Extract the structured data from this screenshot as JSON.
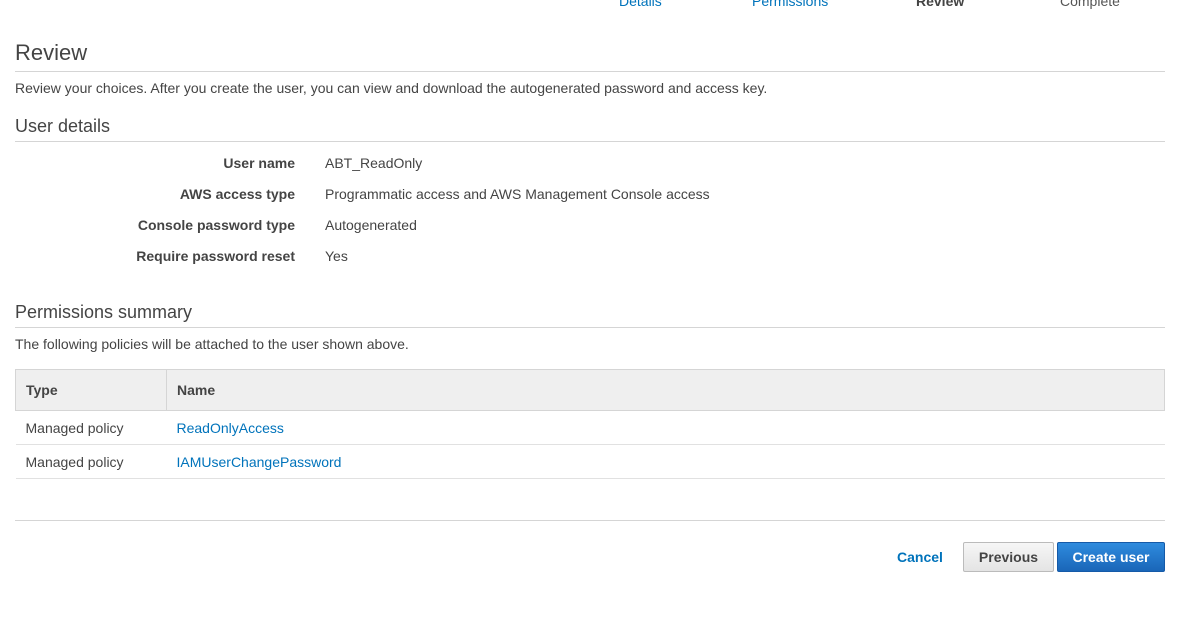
{
  "wizard_steps": [
    {
      "label": "Details",
      "state": "link"
    },
    {
      "label": "Permissions",
      "state": "link"
    },
    {
      "label": "Review",
      "state": "current"
    },
    {
      "label": "Complete",
      "state": "future"
    }
  ],
  "review": {
    "title": "Review",
    "description": "Review your choices. After you create the user, you can view and download the autogenerated password and access key."
  },
  "user_details": {
    "title": "User details",
    "rows": [
      {
        "label": "User name",
        "value": "ABT_ReadOnly"
      },
      {
        "label": "AWS access type",
        "value": "Programmatic access and AWS Management Console access"
      },
      {
        "label": "Console password type",
        "value": "Autogenerated"
      },
      {
        "label": "Require password reset",
        "value": "Yes"
      }
    ]
  },
  "permissions_summary": {
    "title": "Permissions summary",
    "description": "The following policies will be attached to the user shown above.",
    "columns": [
      "Type",
      "Name"
    ],
    "rows": [
      {
        "type": "Managed policy",
        "name": "ReadOnlyAccess"
      },
      {
        "type": "Managed policy",
        "name": "IAMUserChangePassword"
      }
    ]
  },
  "footer": {
    "cancel_label": "Cancel",
    "previous_label": "Previous",
    "create_label": "Create user"
  },
  "colors": {
    "link": "#0073bb",
    "primary_button": "#1a66b8",
    "text": "#444444",
    "table_header_bg": "#efefef",
    "divider": "#d5d5d5"
  }
}
